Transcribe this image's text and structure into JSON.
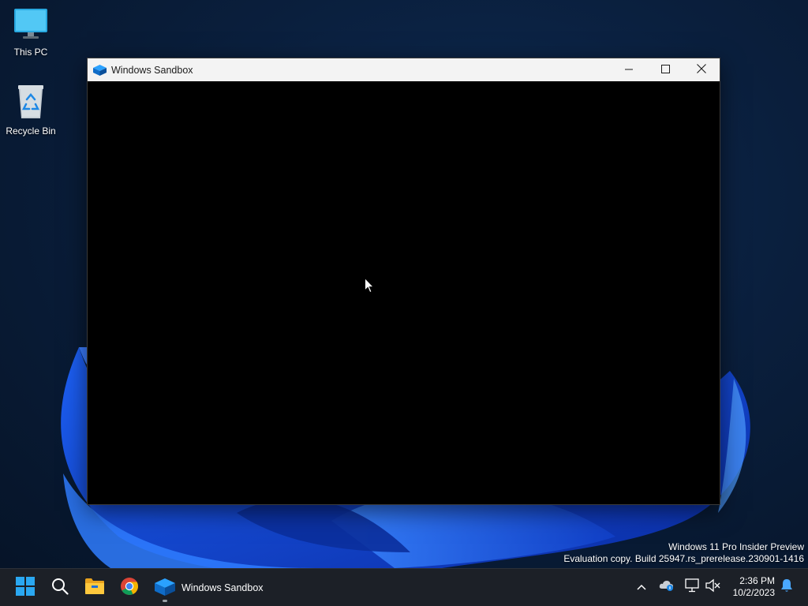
{
  "desktop": {
    "icons": [
      {
        "label": "This PC",
        "icon": "monitor-icon"
      },
      {
        "label": "Recycle Bin",
        "icon": "recycle-bin-icon"
      }
    ],
    "watermark": {
      "line1": "Windows 11 Pro Insider Preview",
      "line2": "Evaluation copy. Build 25947.rs_prerelease.230901-1416"
    }
  },
  "window": {
    "title": "Windows Sandbox",
    "icon": "windows-sandbox-icon",
    "controls": [
      "minimize-icon",
      "maximize-icon",
      "close-icon"
    ],
    "content_color": "#000000"
  },
  "taskbar": {
    "start_icon": "windows-start-icon",
    "search_icon": "search-icon",
    "pinned": [
      "file-explorer-icon",
      "chrome-icon"
    ],
    "running_app": {
      "label": "Windows Sandbox",
      "icon": "windows-sandbox-icon"
    },
    "tray": [
      "chevron-up-icon",
      "onedrive-icon",
      "network-icon",
      "volume-muted-icon",
      "notification-bell-icon"
    ],
    "clock": {
      "time": "2:36 PM",
      "date": "10/2/2023"
    }
  },
  "colors": {
    "accent": "#0078d4",
    "taskbar_bg": "#1c2027",
    "desktop_bg": "#0a1f3d"
  }
}
